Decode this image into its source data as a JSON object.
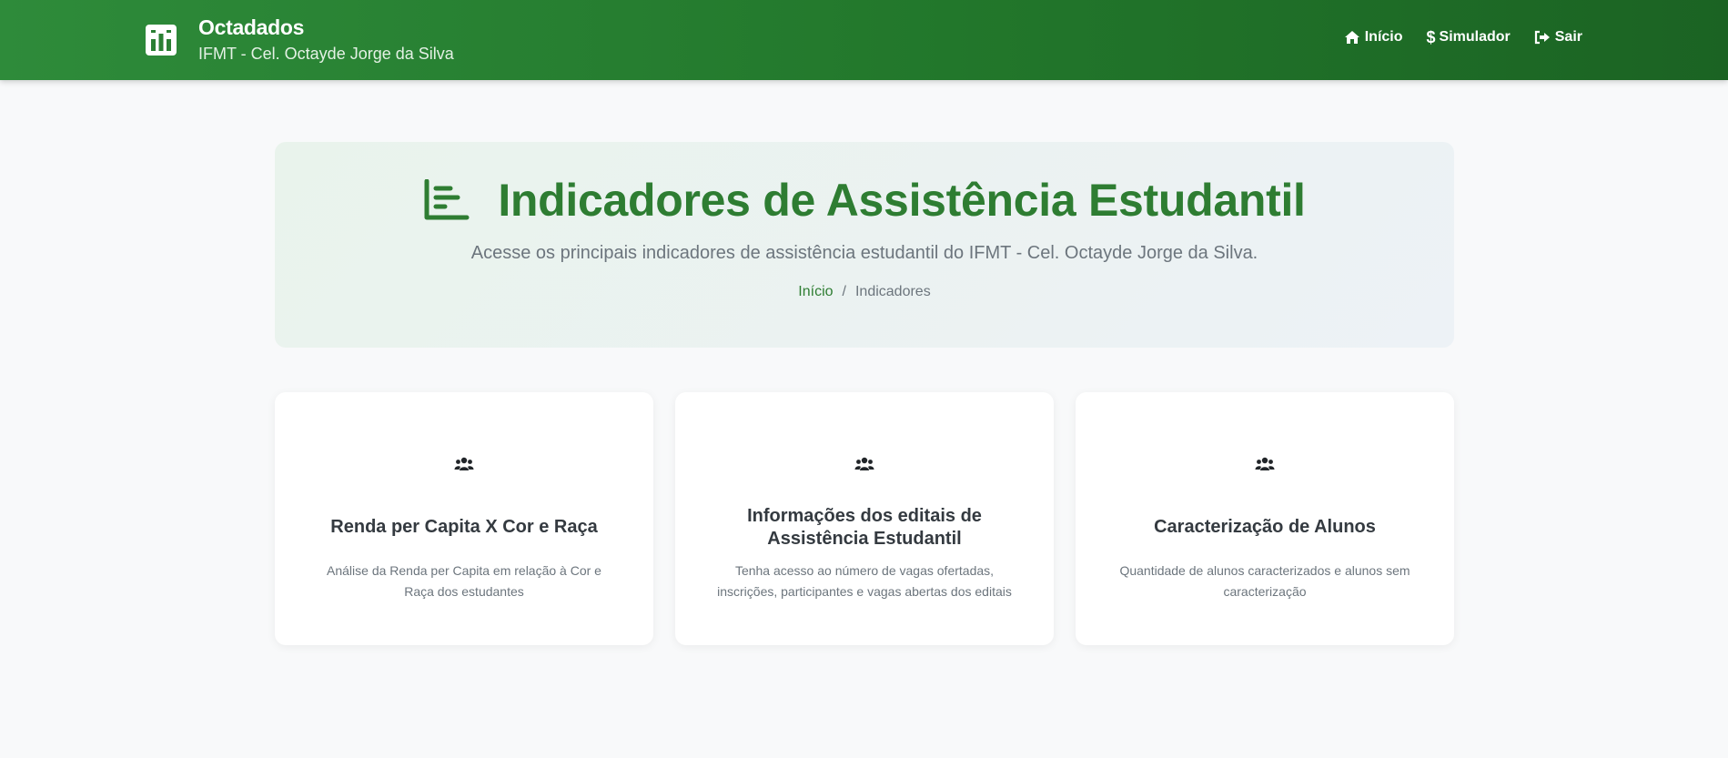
{
  "navbar": {
    "brand_title": "Octadados",
    "brand_subtitle": "IFMT - Cel. Octayde Jorge da Silva",
    "links": [
      {
        "label": "Início",
        "icon": "home-icon"
      },
      {
        "label": "Simulador",
        "icon": "dollar-icon",
        "glyph": "$"
      },
      {
        "label": "Sair",
        "icon": "sign-out-icon"
      }
    ]
  },
  "hero": {
    "title": "Indicadores de Assistência Estudantil",
    "subtitle": "Acesse os principais indicadores de assistência estudantil do IFMT - Cel. Octayde Jorge da Silva.",
    "breadcrumb": {
      "home": "Início",
      "separator": "/",
      "current": "Indicadores"
    }
  },
  "cards": [
    {
      "title": "Renda per Capita X Cor e Raça",
      "description": "Análise da Renda per Capita em relação à Cor e Raça dos estudantes",
      "icon": "users-icon"
    },
    {
      "title": "Informações dos editais de Assistência Estudantil",
      "description": "Tenha acesso ao número de vagas ofertadas, inscrições, participantes e vagas abertas dos editais",
      "icon": "users-icon"
    },
    {
      "title": "Caracterização de Alunos",
      "description": "Quantidade de alunos caracterizados e alunos sem caracterização",
      "icon": "users-icon"
    }
  ],
  "colors": {
    "navbar_start": "#2e8b3a",
    "navbar_end": "#1b6323",
    "accent": "#2e7d32",
    "muted": "#6c757d"
  }
}
